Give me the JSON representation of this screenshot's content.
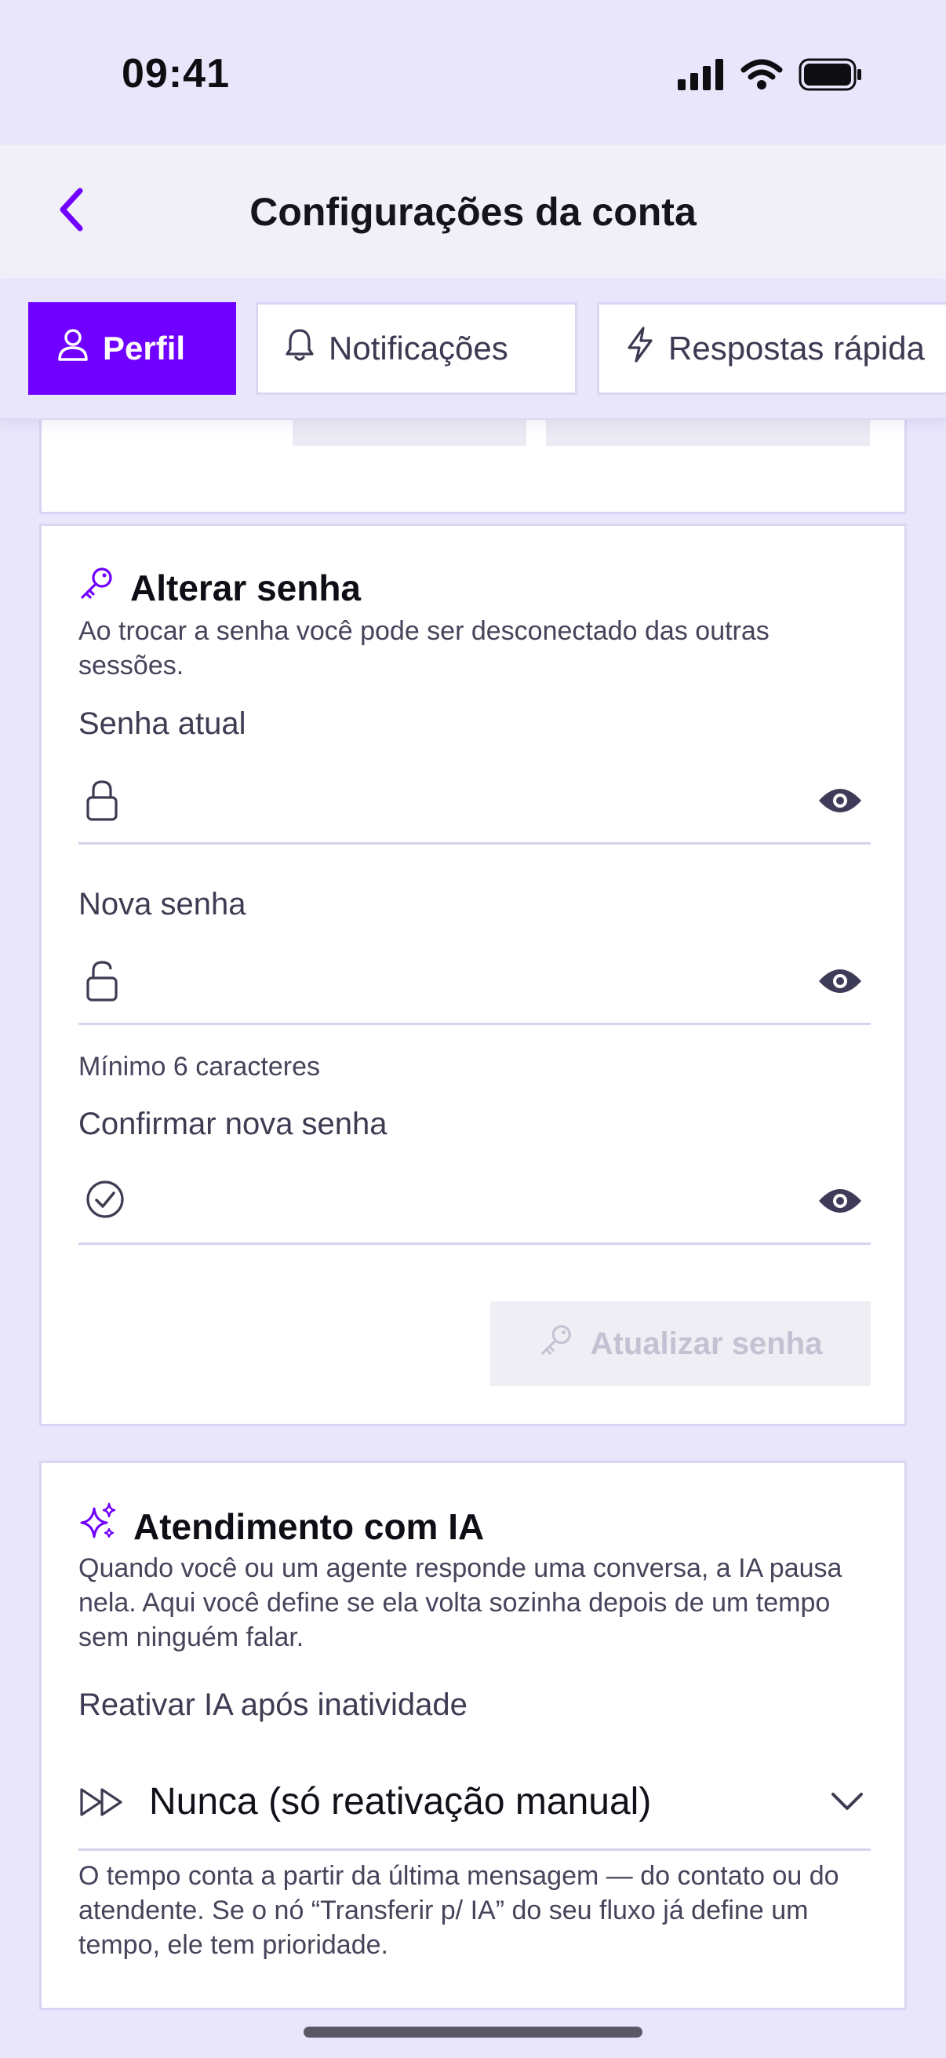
{
  "status_bar": {
    "time": "09:41"
  },
  "nav": {
    "title": "Configurações da conta",
    "back_icon": "chevron-left-icon"
  },
  "tabs": [
    {
      "label": "Perfil",
      "icon": "user-icon",
      "active": true
    },
    {
      "label": "Notificações",
      "icon": "bell-icon",
      "active": false
    },
    {
      "label": "Respostas rápida",
      "icon": "lightning-icon",
      "active": false
    }
  ],
  "password_card": {
    "title": "Alterar senha",
    "title_icon": "key-icon",
    "description": "Ao trocar a senha você pode ser desconectado das outras sessões.",
    "current_label": "Senha atual",
    "current_value": "",
    "new_label": "Nova senha",
    "new_value": "",
    "new_hint": "Mínimo 6 caracteres",
    "confirm_label": "Confirmar nova senha",
    "confirm_value": "",
    "submit_label": "Atualizar senha"
  },
  "ai_card": {
    "title": "Atendimento com IA",
    "title_icon": "sparkles-icon",
    "description": "Quando você ou um agente responde uma conversa, a IA pausa nela. Aqui você define se ela volta sozinha depois de um tempo sem ninguém falar.",
    "reactivate_label": "Reativar IA após inatividade",
    "reactivate_value": "Nunca (só reativação manual)",
    "note": "O tempo conta a partir da última mensagem — do contato ou do atendente. Se o nó “Transferir p/ IA” do seu fluxo já define um tempo, ele tem prioridade."
  },
  "colors": {
    "accent": "#7000ff",
    "background": "#e9e6fb",
    "card_border": "#d9d5f3",
    "text_muted": "#45445a"
  }
}
